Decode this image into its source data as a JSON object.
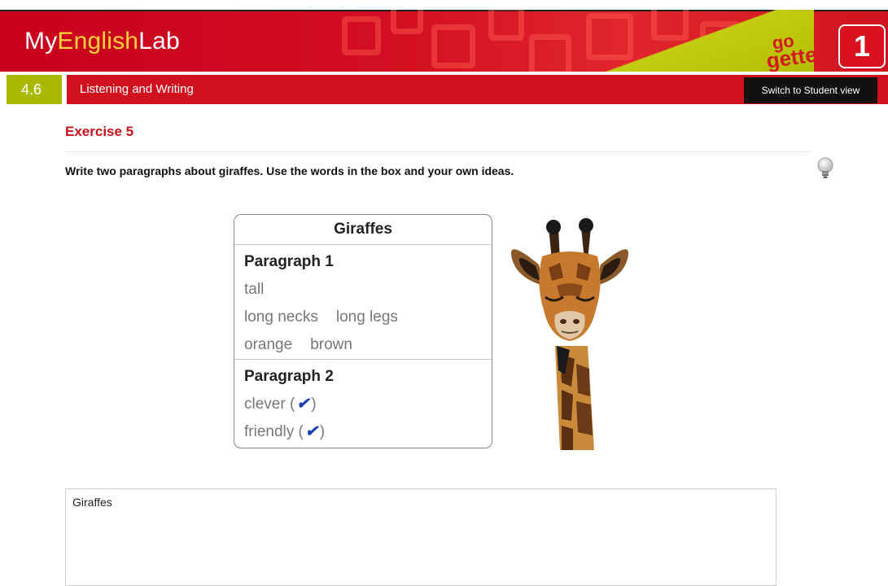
{
  "header": {
    "brand_part1": "My",
    "brand_part2": "English",
    "brand_part3": "Lab",
    "gogetter_line1": "go",
    "gogetter_line2": "getter",
    "level": "1"
  },
  "unit": {
    "number": "4.6",
    "title": "Listening and Writing",
    "switch_view_label": "Switch to Student view"
  },
  "exercise": {
    "title": "Exercise 5",
    "instructions": "Write two paragraphs about giraffes. Use the words in the box and your own ideas."
  },
  "wordbox": {
    "title": "Giraffes",
    "paragraph1": {
      "heading": "Paragraph 1",
      "line1": [
        "tall"
      ],
      "line2": [
        "long necks",
        "long legs"
      ],
      "line3": [
        "orange",
        "brown"
      ]
    },
    "paragraph2": {
      "heading": "Paragraph 2",
      "line1": "clever (",
      "line1_end": ")",
      "line2": "friendly (",
      "line2_end": ")",
      "tick": "✔"
    }
  },
  "answer": {
    "text": "Giraffes"
  },
  "colors": {
    "brand_red": "#d0101d",
    "accent_lime": "#a9b900",
    "brand_yellow": "#ffd23d"
  }
}
